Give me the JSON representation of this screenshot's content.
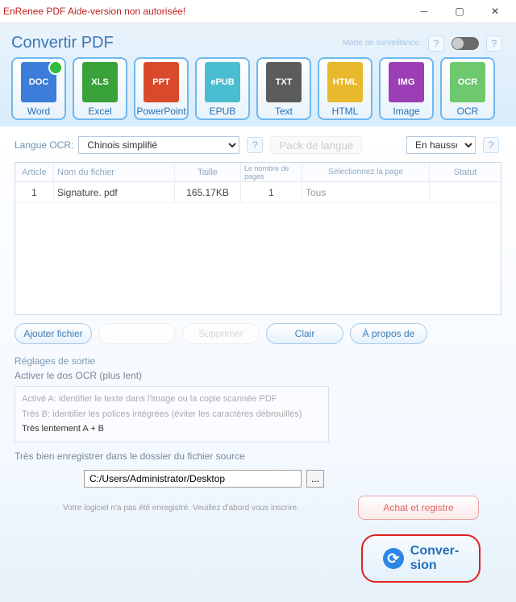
{
  "window": {
    "title": "EnRenee PDF Aide-version non autorisée!"
  },
  "header": {
    "title": "Convertir PDF",
    "mode_label": "Mode de surveillance:"
  },
  "formats": [
    {
      "label": "Word",
      "selected": true
    },
    {
      "label": "Excel"
    },
    {
      "label": "PowerPoint"
    },
    {
      "label": "EPUB"
    },
    {
      "label": "Text"
    },
    {
      "label": "HTML"
    },
    {
      "label": "Image"
    },
    {
      "label": "OCR"
    }
  ],
  "ocr": {
    "label": "Langue OCR:",
    "language": "Chinois simplifié",
    "pack_btn": "Pack de langue",
    "direction": "En hausse"
  },
  "table": {
    "headers": {
      "c1": "Article",
      "c2": "Nom du fichier",
      "c3": "Taille",
      "c4": "Le nombre de pages",
      "c5": "Sélectionnez la page",
      "c6": "Statut"
    },
    "rows": [
      {
        "c1": "1",
        "c2": "Signature. pdf",
        "c3": "165.17KB",
        "c4": "1",
        "c5": "Tous",
        "c6": ""
      }
    ]
  },
  "buttons": {
    "add": "Ajouter fichier",
    "b2": "",
    "b3": "Supprimer",
    "clear": "Clair",
    "about": "À propos de"
  },
  "settings": {
    "title": "Réglages de sortie",
    "sub": "Activer le dos OCR (plus lent)",
    "lineA": "Activé A: identifier le texte dans l'image ou la copie scannée PDF",
    "lineB": "Très B: identifier les polices intégrées (éviter les caractères débrouillés)",
    "lineC": "Très lentement A + B"
  },
  "save": {
    "label": "Très bien enregistrer dans le dossier du fichier source",
    "path": "C:/Users/Administrator/Desktop"
  },
  "convert": {
    "line1": "Conver-",
    "line2": "sion"
  },
  "footer": {
    "text": "Votre logiciel n'a pas été enregistré. Veuillez d'abord vous inscrire.",
    "buy": "Achat et registre"
  }
}
